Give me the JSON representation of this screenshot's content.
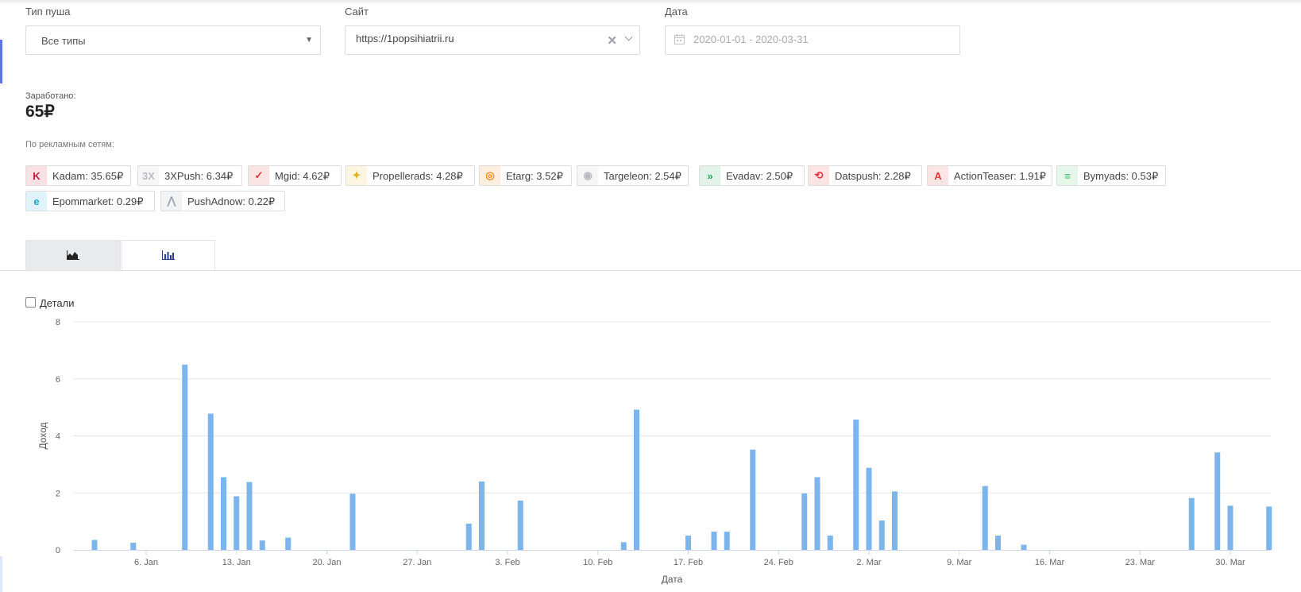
{
  "filters": {
    "push_type": {
      "label": "Тип пуша",
      "value": "Все типы"
    },
    "site": {
      "label": "Сайт",
      "value": "https://1popsihiatrii.ru",
      "clear_glyph": "✕"
    },
    "date": {
      "label": "Дата",
      "value": "2020-01-01 - 2020-03-31"
    }
  },
  "earned": {
    "label": "Заработано:",
    "value": "65₽"
  },
  "networks": {
    "label": "По рекламным сетям:",
    "items": [
      {
        "name": "kadam",
        "text": "Kadam: 35.65₽",
        "color": "#c8193c",
        "glyph": "K"
      },
      {
        "name": "3xpush",
        "text": "3XPush: 6.34₽",
        "color": "#b9bcc3",
        "glyph": "3X"
      },
      {
        "name": "mgid",
        "text": "Mgid: 4.62₽",
        "color": "#d9362b",
        "glyph": "✓"
      },
      {
        "name": "propellerads",
        "text": "Propellerads: 4.28₽",
        "color": "#e0b21c",
        "glyph": "✦"
      },
      {
        "name": "etarg",
        "text": "Etarg: 3.52₽",
        "color": "#f08a18",
        "glyph": "◎"
      },
      {
        "name": "targeleon",
        "text": "Targeleon: 2.54₽",
        "color": "#b8b8be",
        "glyph": "◉"
      },
      {
        "name": "evadav",
        "text": "Evadav: 2.50₽",
        "color": "#1fa85b",
        "glyph": "»"
      },
      {
        "name": "datspush",
        "text": "Datspush: 2.28₽",
        "color": "#e8323c",
        "glyph": "⟲"
      },
      {
        "name": "actionteaser",
        "text": "ActionTeaser: 1.91₽",
        "color": "#e23a36",
        "glyph": "A"
      },
      {
        "name": "bymyads",
        "text": "Bymyads: 0.53₽",
        "color": "#3ec26b",
        "glyph": "≡"
      },
      {
        "name": "epommarket",
        "text": "Epommarket: 0.29₽",
        "color": "#1aa7d8",
        "glyph": "e"
      },
      {
        "name": "pushadnow",
        "text": "PushAdnow: 0.22₽",
        "color": "#9aa3ad",
        "glyph": "⋀"
      }
    ]
  },
  "tabs": [
    {
      "name": "area-chart",
      "active": false
    },
    {
      "name": "bar-chart",
      "active": true
    }
  ],
  "details_checkbox": {
    "label": "Детали",
    "checked": false
  },
  "chart_data": {
    "type": "bar",
    "xlabel": "Дата",
    "ylabel": "Доход",
    "ylim": [
      0,
      8
    ],
    "yticks": [
      0,
      2,
      4,
      6,
      8
    ],
    "x_range": [
      "2020-01-01",
      "2020-03-31"
    ],
    "xticks": [
      {
        "date": "2020-01-06",
        "label": "6. Jan"
      },
      {
        "date": "2020-01-13",
        "label": "13. Jan"
      },
      {
        "date": "2020-01-20",
        "label": "20. Jan"
      },
      {
        "date": "2020-01-27",
        "label": "27. Jan"
      },
      {
        "date": "2020-02-03",
        "label": "3. Feb"
      },
      {
        "date": "2020-02-10",
        "label": "10. Feb"
      },
      {
        "date": "2020-02-17",
        "label": "17. Feb"
      },
      {
        "date": "2020-02-24",
        "label": "24. Feb"
      },
      {
        "date": "2020-03-02",
        "label": "2. Mar"
      },
      {
        "date": "2020-03-09",
        "label": "9. Mar"
      },
      {
        "date": "2020-03-16",
        "label": "16. Mar"
      },
      {
        "date": "2020-03-23",
        "label": "23. Mar"
      },
      {
        "date": "2020-03-30",
        "label": "30. Mar"
      }
    ],
    "points": [
      {
        "date": "2020-01-02",
        "value": 0.35
      },
      {
        "date": "2020-01-05",
        "value": 0.25
      },
      {
        "date": "2020-01-09",
        "value": 6.5
      },
      {
        "date": "2020-01-11",
        "value": 4.78
      },
      {
        "date": "2020-01-12",
        "value": 2.55
      },
      {
        "date": "2020-01-13",
        "value": 1.88
      },
      {
        "date": "2020-01-14",
        "value": 2.38
      },
      {
        "date": "2020-01-15",
        "value": 0.33
      },
      {
        "date": "2020-01-17",
        "value": 0.43
      },
      {
        "date": "2020-01-22",
        "value": 1.97
      },
      {
        "date": "2020-01-31",
        "value": 0.92
      },
      {
        "date": "2020-02-01",
        "value": 2.4
      },
      {
        "date": "2020-02-04",
        "value": 1.73
      },
      {
        "date": "2020-02-12",
        "value": 0.27
      },
      {
        "date": "2020-02-13",
        "value": 4.92
      },
      {
        "date": "2020-02-17",
        "value": 0.5
      },
      {
        "date": "2020-02-19",
        "value": 0.64
      },
      {
        "date": "2020-02-20",
        "value": 0.64
      },
      {
        "date": "2020-02-22",
        "value": 3.52
      },
      {
        "date": "2020-02-26",
        "value": 1.98
      },
      {
        "date": "2020-02-27",
        "value": 2.55
      },
      {
        "date": "2020-02-28",
        "value": 0.5
      },
      {
        "date": "2020-03-01",
        "value": 4.57
      },
      {
        "date": "2020-03-02",
        "value": 2.88
      },
      {
        "date": "2020-03-03",
        "value": 1.03
      },
      {
        "date": "2020-03-04",
        "value": 2.05
      },
      {
        "date": "2020-03-11",
        "value": 2.24
      },
      {
        "date": "2020-03-12",
        "value": 0.5
      },
      {
        "date": "2020-03-14",
        "value": 0.18
      },
      {
        "date": "2020-03-27",
        "value": 1.82
      },
      {
        "date": "2020-03-29",
        "value": 3.42
      },
      {
        "date": "2020-03-30",
        "value": 1.55
      },
      {
        "date": "2020-04-02",
        "value": 1.52
      }
    ],
    "colors": {
      "bar": "#7cb5ec",
      "grid": "#e6e6e6",
      "axis": "#ccd6eb"
    }
  }
}
